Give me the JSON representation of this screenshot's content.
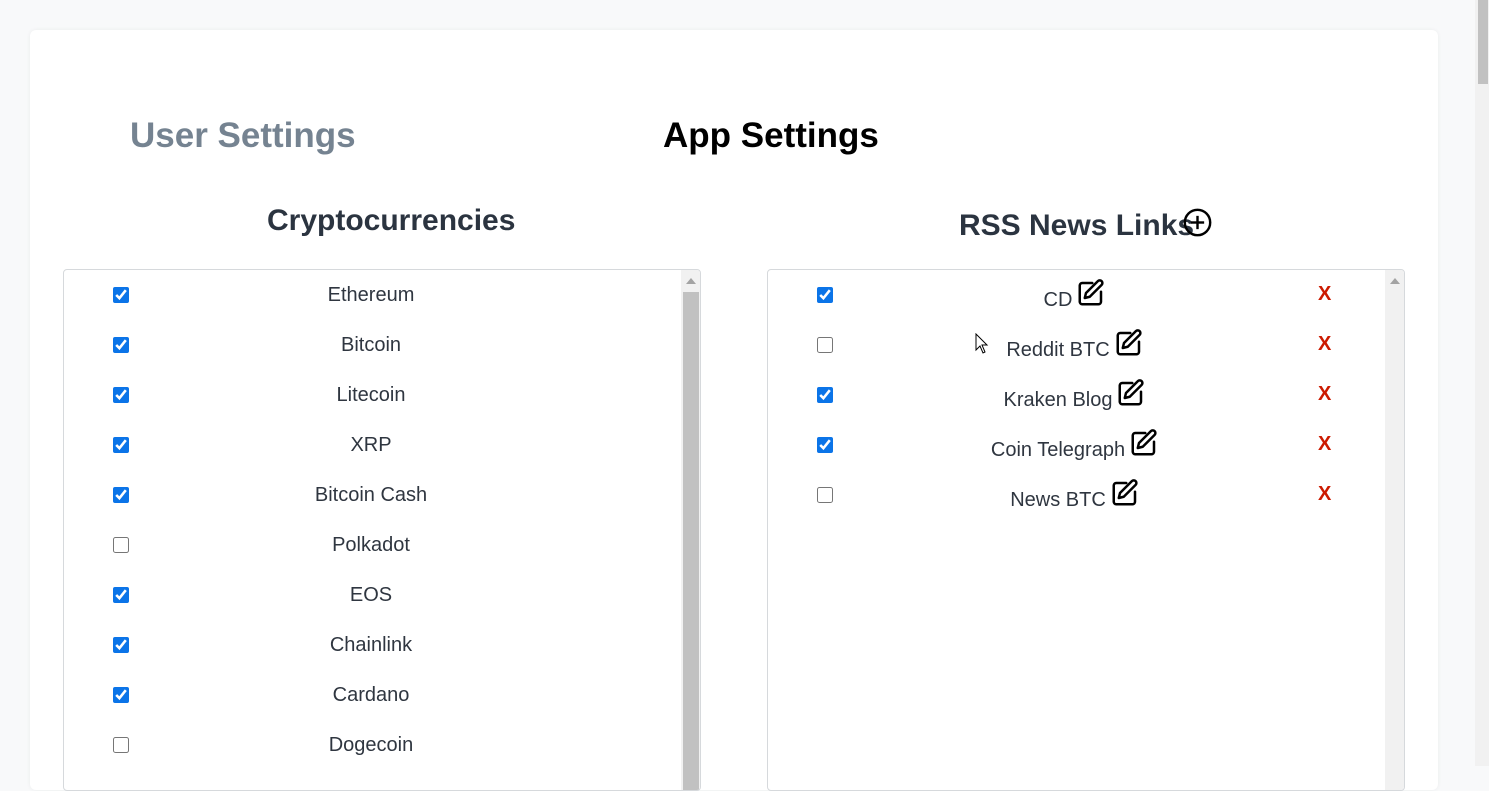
{
  "tabs": {
    "user_settings": "User Settings",
    "app_settings": "App Settings"
  },
  "crypto": {
    "title": "Cryptocurrencies",
    "items": [
      {
        "label": "Ethereum",
        "checked": true
      },
      {
        "label": "Bitcoin",
        "checked": true
      },
      {
        "label": "Litecoin",
        "checked": true
      },
      {
        "label": "XRP",
        "checked": true
      },
      {
        "label": "Bitcoin Cash",
        "checked": true
      },
      {
        "label": "Polkadot",
        "checked": false
      },
      {
        "label": "EOS",
        "checked": true
      },
      {
        "label": "Chainlink",
        "checked": true
      },
      {
        "label": "Cardano",
        "checked": true
      },
      {
        "label": "Dogecoin",
        "checked": false
      }
    ]
  },
  "rss": {
    "title": "RSS News Links",
    "add_icon": "plus-circle-icon",
    "delete_label": "X",
    "items": [
      {
        "label": "CD",
        "checked": true
      },
      {
        "label": "Reddit BTC",
        "checked": false
      },
      {
        "label": "Kraken Blog",
        "checked": true
      },
      {
        "label": "Coin Telegraph",
        "checked": true
      },
      {
        "label": "News BTC",
        "checked": false
      }
    ]
  },
  "colors": {
    "active_tab": "#000000",
    "inactive_tab": "#758391",
    "checkbox_accent": "#0b74e8",
    "delete": "#cc1a00"
  }
}
